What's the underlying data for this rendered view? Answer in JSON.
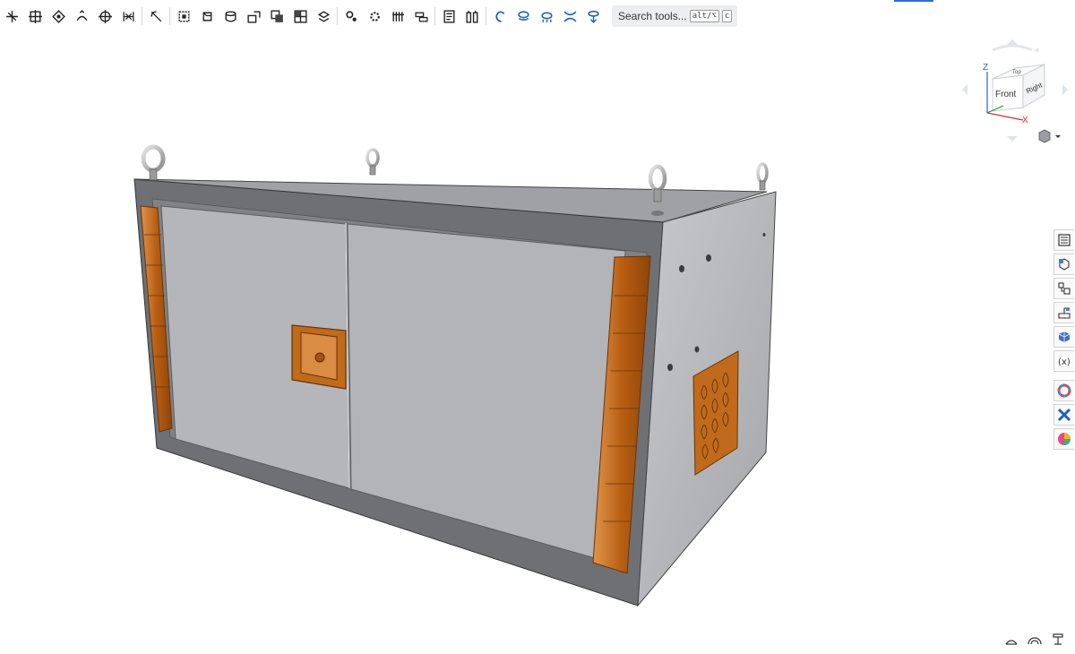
{
  "toolbar": {
    "search_label": "Search tools...",
    "shortcut_keys": [
      "alt/⌥",
      "c"
    ],
    "accent_color": "#2f6cd6",
    "icons": [
      "sketch-icon",
      "extrude-icon",
      "revolve-icon",
      "sweep-icon",
      "loft-icon",
      "thicken-icon",
      "fillet-icon",
      "chamfer-icon",
      "draft-icon",
      "shell-icon",
      "hole-icon",
      "boolean-icon",
      "split-icon",
      "transform-icon",
      "pattern-icon",
      "mirror-icon",
      "mate-connector-icon",
      "plane-icon",
      "helix-icon",
      "variable-icon",
      "sheet-metal-icon",
      "frame-icon",
      "curve-icon",
      "surface-icon",
      "wrap-icon",
      "measure-icon"
    ]
  },
  "viewcube": {
    "face_front": "Front",
    "face_right": "Right",
    "face_top": "Top",
    "axis_z": "Z",
    "axis_x": "X"
  },
  "right_rail": {
    "icons": [
      "feature-list-icon",
      "parts-icon",
      "assembly-icon",
      "sheet-metal-table-icon",
      "appearance-icon",
      "variables-icon",
      "app-store-icon-1",
      "app-store-icon-2",
      "app-store-icon-3"
    ]
  },
  "colors": {
    "box_body": "#a9abae",
    "box_front": "#b6b8bb",
    "hinge": "#c26a1c",
    "frame": "#6f7073"
  }
}
